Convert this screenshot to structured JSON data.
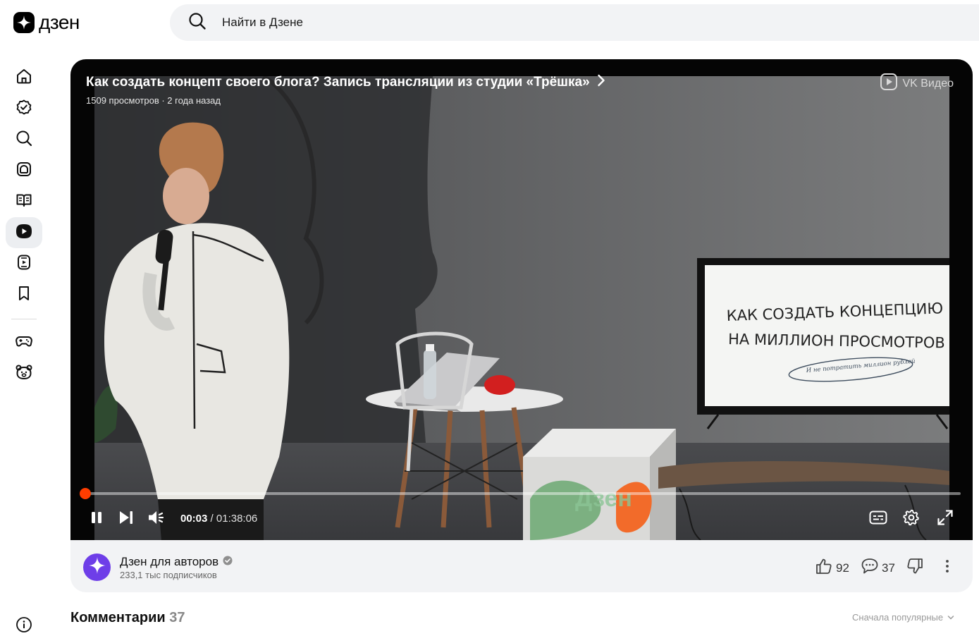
{
  "header": {
    "logo_text": "дзен",
    "search_placeholder": "Найти в Дзене"
  },
  "sidebar": {
    "items": [
      {
        "icon": "home-icon"
      },
      {
        "icon": "subscriptions-icon"
      },
      {
        "icon": "search-icon"
      },
      {
        "icon": "news-icon"
      },
      {
        "icon": "articles-icon"
      },
      {
        "icon": "video-icon",
        "active": true
      },
      {
        "icon": "shorts-icon"
      },
      {
        "icon": "bookmark-icon"
      }
    ],
    "extra": [
      {
        "icon": "gamepad-icon"
      },
      {
        "icon": "kids-icon"
      }
    ],
    "bottom": {
      "icon": "info-icon"
    }
  },
  "video": {
    "title": "Как создать концепт своего блога? Запись трансляции из студии «Трёшка»",
    "meta": "1509 просмотров · 2 года назад",
    "provider": "VK Видео",
    "screen_line1": "КАК СОЗДАТЬ КОНЦЕПЦИЮ",
    "screen_line2": "НА МИЛЛИОН ПРОСМОТРОВ",
    "screen_line3": "И не потратить миллион рублей",
    "cube_logo": "Дзен",
    "time_current": "00:03",
    "time_separator": " / ",
    "time_total": "01:38:06",
    "progress_fraction": 0.0005
  },
  "channel": {
    "name": "Дзен для авторов",
    "subscribers": "233,1 тыс подписчиков",
    "likes": "92",
    "comments": "37"
  },
  "comments": {
    "title": "Комментарии",
    "count": "37",
    "sort_label": "Сначала популярные"
  },
  "colors": {
    "accent": "#ff3d00",
    "channel_avatar": "#6e3ee8",
    "surface": "#f2f3f5"
  }
}
